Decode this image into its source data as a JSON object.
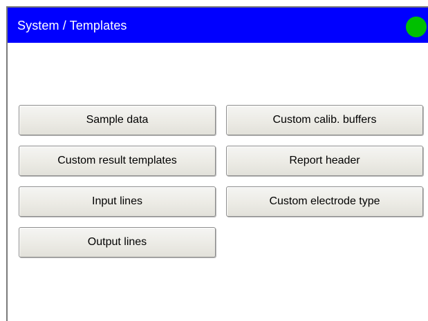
{
  "window": {
    "title": "System / Templates",
    "title_bar_color": "#0000ff",
    "status_indicator_color": "#00c000",
    "status_icon": "status-led-icon"
  },
  "buttons": {
    "sample_data": "Sample data",
    "custom_calib_buffers": "Custom calib. buffers",
    "custom_result_templates": "Custom result templates",
    "report_header": "Report header",
    "input_lines": "Input lines",
    "custom_electrode_type": "Custom electrode type",
    "output_lines": "Output lines"
  }
}
